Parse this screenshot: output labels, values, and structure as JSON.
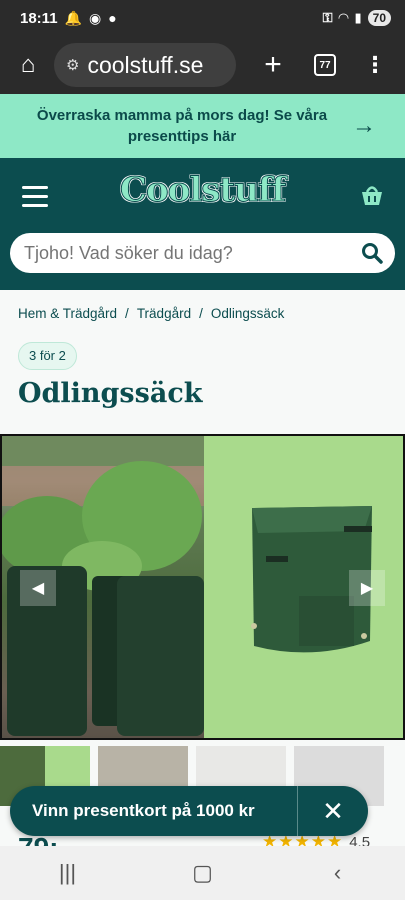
{
  "status_bar": {
    "time": "18:11",
    "battery": "70"
  },
  "browser": {
    "url": "coolstuff.se",
    "tab_count": "77"
  },
  "promo": {
    "text": "Överraska mamma på mors dag! Se våra presenttips här"
  },
  "header": {
    "logo": "Coolstuff"
  },
  "search": {
    "placeholder": "Tjoho! Vad söker du idag?"
  },
  "breadcrumbs": [
    "Hem & Trädgård",
    "Trädgård",
    "Odlingssäck"
  ],
  "product": {
    "badge": "3 för 2",
    "title": "Odlingssäck",
    "price_peek": "79:",
    "rating": "4.5"
  },
  "toast": {
    "text": "Vinn presentkort på 1000 kr"
  },
  "colors": {
    "brand": "#0c4d4f",
    "accent": "#8ee8c6",
    "star": "#f2b400"
  }
}
